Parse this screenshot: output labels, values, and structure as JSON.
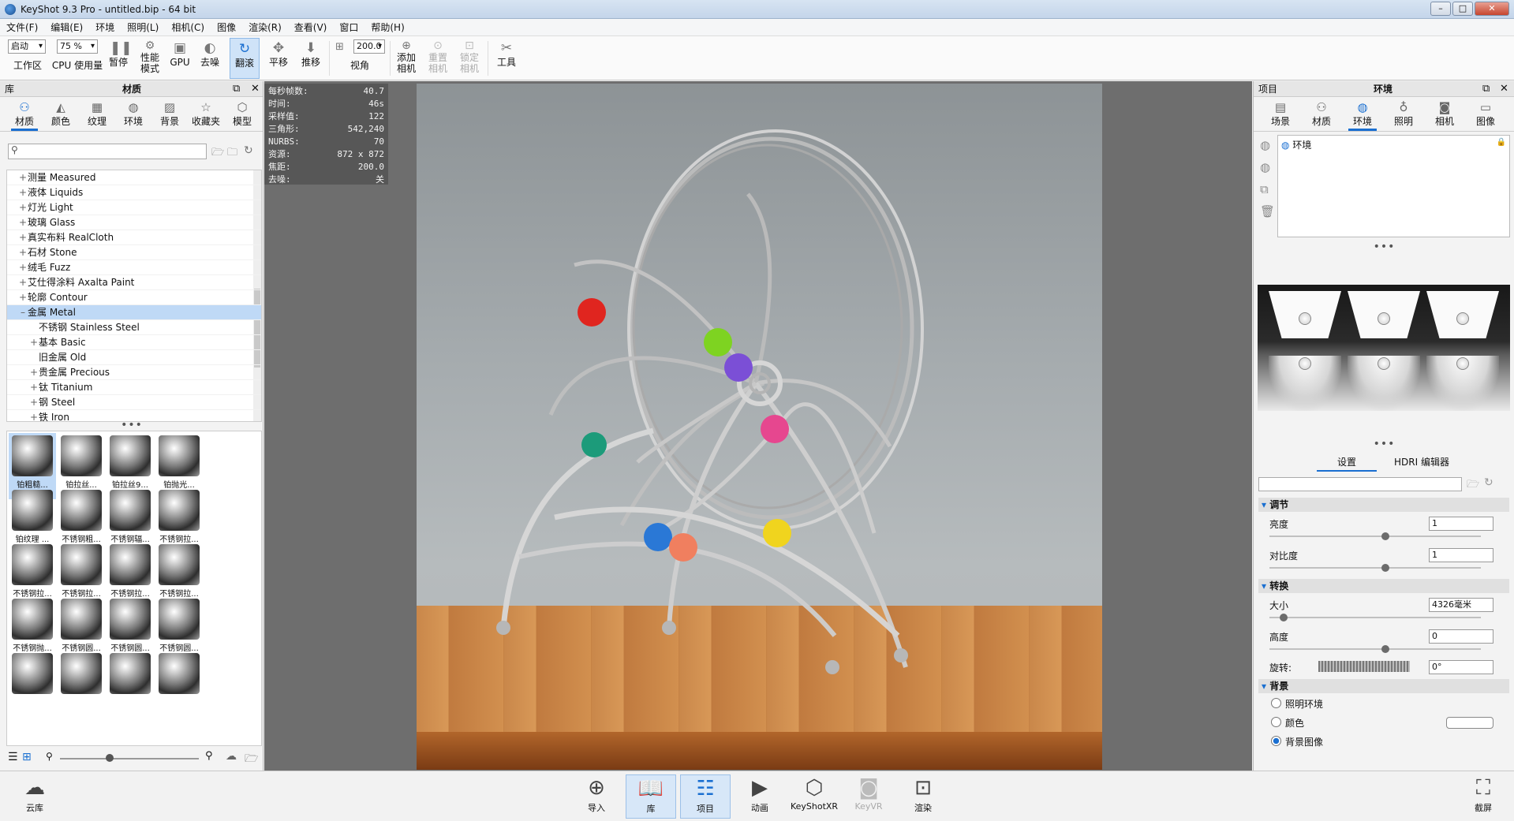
{
  "titlebar": {
    "title": "KeyShot 9.3 Pro  - untitled.bip  - 64 bit",
    "min": "–",
    "max": "□",
    "close": "✕"
  },
  "menu": [
    "文件(F)",
    "编辑(E)",
    "环境",
    "照明(L)",
    "相机(C)",
    "图像",
    "渲染(R)",
    "查看(V)",
    "窗口",
    "帮助(H)"
  ],
  "toolbar": {
    "workspace_select": "启动",
    "workspace": "工作区",
    "cpu_select": "75 %",
    "cpu": "CPU 使用量",
    "pause": "暂停",
    "perf1": "性能",
    "perf2": "模式",
    "gpu": "GPU",
    "denoise": "去噪",
    "tumble": "翻滚",
    "pan": "平移",
    "dolly": "推移",
    "fov_value": "200.0",
    "fov": "视角",
    "add_camera1": "添加",
    "add_camera2": "相机",
    "reset_camera1": "重置",
    "reset_camera2": "相机",
    "lock_camera1": "锁定",
    "lock_camera2": "相机",
    "tools": "工具"
  },
  "left": {
    "panel_label": "库",
    "title": "材质",
    "tabs": [
      "材质",
      "颜色",
      "纹理",
      "环境",
      "背景",
      "收藏夹",
      "模型"
    ],
    "tree": [
      {
        "exp": "+",
        "label": "测量 Measured",
        "indent": 1
      },
      {
        "exp": "+",
        "label": "液体 Liquids",
        "indent": 1
      },
      {
        "exp": "+",
        "label": "灯光 Light",
        "indent": 1
      },
      {
        "exp": "+",
        "label": "玻璃 Glass",
        "indent": 1
      },
      {
        "exp": "+",
        "label": "真实布料 RealCloth",
        "indent": 1
      },
      {
        "exp": "+",
        "label": "石材 Stone",
        "indent": 1
      },
      {
        "exp": "+",
        "label": "绒毛 Fuzz",
        "indent": 1
      },
      {
        "exp": "+",
        "label": "艾仕得涂料 Axalta Paint",
        "indent": 1
      },
      {
        "exp": "+",
        "label": "轮廓 Contour",
        "indent": 1
      },
      {
        "exp": "–",
        "label": "金属 Metal",
        "indent": 1,
        "selected": true
      },
      {
        "exp": "",
        "label": "不锈钢 Stainless Steel",
        "indent": 2
      },
      {
        "exp": "+",
        "label": "基本 Basic",
        "indent": 2
      },
      {
        "exp": "",
        "label": "旧金属 Old",
        "indent": 2
      },
      {
        "exp": "+",
        "label": "贵金属 Precious",
        "indent": 2
      },
      {
        "exp": "+",
        "label": "钛 Titanium",
        "indent": 2
      },
      {
        "exp": "+",
        "label": "钢 Steel",
        "indent": 2
      },
      {
        "exp": "+",
        "label": "铁 Iron",
        "indent": 2
      }
    ],
    "thumbs": [
      "铂粗糙...",
      "铂拉丝...",
      "铂拉丝9...",
      "铂抛光...",
      "铂纹理 ...",
      "不锈钢粗...",
      "不锈钢辐...",
      "不锈钢拉...",
      "不锈钢拉...",
      "不锈钢拉...",
      "不锈钢拉...",
      "不锈钢拉...",
      "不锈钢抛...",
      "不锈钢圆...",
      "不锈钢圆...",
      "不锈钢圆...",
      "",
      "",
      "",
      ""
    ]
  },
  "stats": [
    {
      "k": "每秒帧数:",
      "v": "40.7"
    },
    {
      "k": "时间:",
      "v": "46s"
    },
    {
      "k": "采样值:",
      "v": "122"
    },
    {
      "k": "三角形:",
      "v": "542,240"
    },
    {
      "k": "NURBS:",
      "v": "70"
    },
    {
      "k": "资源:",
      "v": "872 x 872"
    },
    {
      "k": "焦距:",
      "v": "200.0"
    },
    {
      "k": "去噪:",
      "v": "关"
    }
  ],
  "right": {
    "panel_label": "项目",
    "title": "环境",
    "tabs": [
      "场景",
      "材质",
      "环境",
      "照明",
      "相机",
      "图像"
    ],
    "env_item": "环境",
    "subtab_settings": "设置",
    "subtab_hdri": "HDRI 编辑器",
    "sections": {
      "adjust": "调节",
      "transform": "转换",
      "background": "背景"
    },
    "brightness_label": "亮度",
    "brightness": "1",
    "brightness_pos": 0.55,
    "contrast_label": "对比度",
    "contrast": "1",
    "contrast_pos": 0.55,
    "size_label": "大小",
    "size": "4326毫米",
    "size_pos": 0.05,
    "height_label": "高度",
    "height": "0",
    "height_pos": 0.55,
    "rotation_label": "旋转:",
    "rotation": "0°",
    "bg_options": [
      "照明环境",
      "颜色",
      "背景图像"
    ],
    "bg_selected": 2
  },
  "bottom": {
    "cloud": "云库",
    "import": "导入",
    "library": "库",
    "project": "项目",
    "animation": "动画",
    "keyshotxr": "KeyShotXR",
    "keyvr": "KeyVR",
    "render": "渲染",
    "screenshot": "截屏"
  }
}
